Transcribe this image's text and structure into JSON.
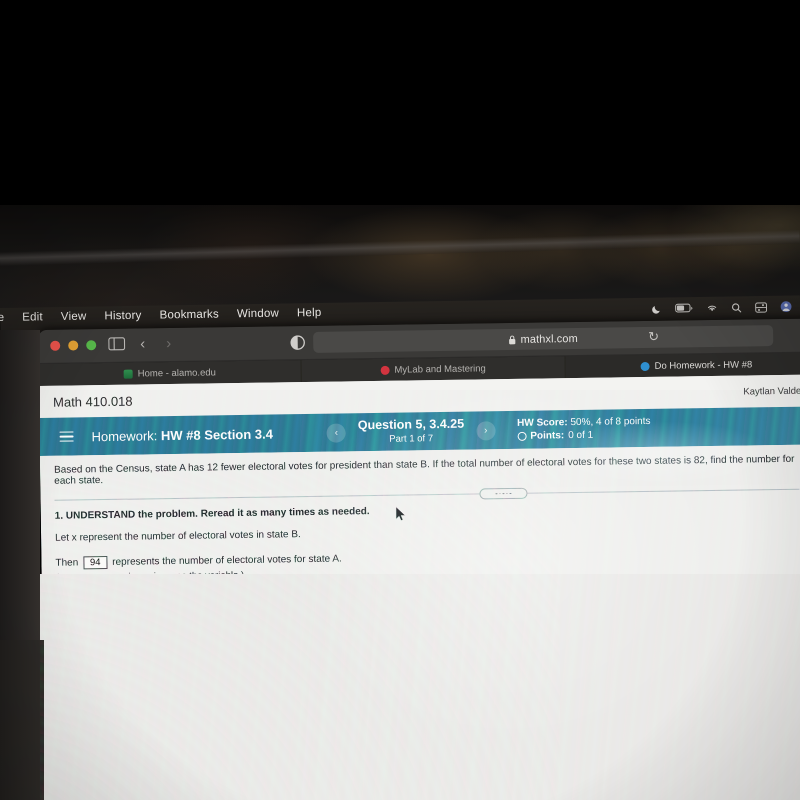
{
  "os_menubar": {
    "items": [
      "ile",
      "Edit",
      "View",
      "History",
      "Bookmarks",
      "Window",
      "Help"
    ],
    "status_icons": [
      "moon-icon",
      "battery-icon",
      "wifi-icon",
      "search-icon",
      "control-center-icon",
      "user-avatar-icon"
    ]
  },
  "browser": {
    "window_controls": [
      "close-button",
      "minimize-button",
      "zoom-button"
    ],
    "sidebar_icon": "sidebar-icon",
    "back_label": "‹",
    "forward_label": "›",
    "reader_icon": "reader-view-icon",
    "lock_icon": "lock-icon",
    "url": "mathxl.com",
    "reload_label": "↻",
    "tabs": [
      {
        "label": "Home - alamo.edu",
        "favicon": "alamo-mountain-icon",
        "active": false
      },
      {
        "label": "MyLab and Mastering",
        "favicon": "mylab-icon",
        "active": false
      },
      {
        "label": "Do Homework - HW #8",
        "favicon": "pearson-icon",
        "active": true
      }
    ]
  },
  "page": {
    "course_title": "Math 410.018",
    "account_name": "Kaytlan Valdez",
    "account_icon": "person-icon",
    "header": {
      "menu_icon": "hamburger-menu-icon",
      "homework_label": "Homework:",
      "homework_name": "HW #8 Section 3.4",
      "prev_label": "‹",
      "next_label": "›",
      "question_number": "Question 5, 3.4.25",
      "question_part": "Part 1 of 7",
      "hw_score_label": "HW Score:",
      "hw_score_value": "50%, 4 of 8 points",
      "points_label": "Points:",
      "points_value": "0 of 1",
      "accent_color": "#2e7b96"
    },
    "problem_text": "Based on the Census, state A has 12 fewer electoral votes for president than state B. If the total number of electoral votes for these two states is 82, find the number for each state.",
    "more_handle": "ellipsis-handle",
    "steps": {
      "step1": "1. UNDERSTAND the problem. Reread it as many times as needed.",
      "let_x": "Let x represent the number of electoral votes in state B.",
      "then_prefix": "Then",
      "answer_value": "94",
      "then_suffix": "represents the number of electoral votes for state A.",
      "type_hint": "(Type an expression using x as the variable.)"
    }
  },
  "cursor": {
    "icon": "mouse-pointer-icon"
  }
}
